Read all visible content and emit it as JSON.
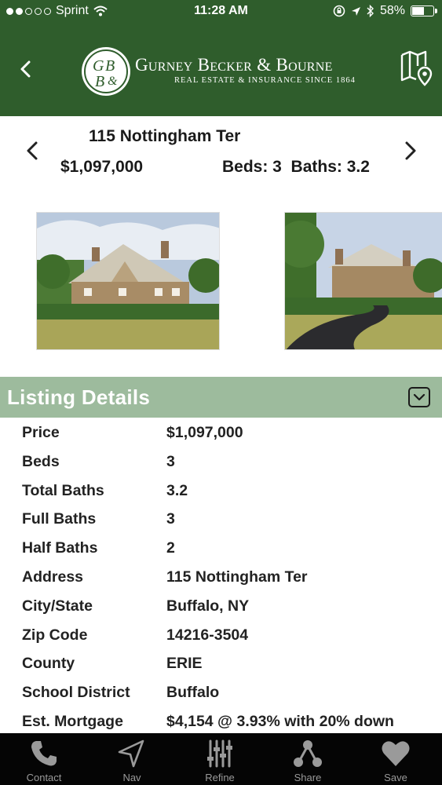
{
  "status_bar": {
    "carrier": "Sprint",
    "time": "11:28 AM",
    "battery": "58%",
    "battery_level": 0.58,
    "signal_bars_filled": 2,
    "signal_bars_total": 5
  },
  "header": {
    "brand_name": "Gurney Becker & Bourne",
    "brand_tagline": "Real Estate & Insurance Since 1864",
    "logo_monogram": "GB&B",
    "back_icon": "chevron-left-icon",
    "map_icon": "map-pin-icon",
    "color": "#2f5d2c"
  },
  "summary": {
    "address": "115 Nottingham Ter",
    "price": "$1,097,000",
    "beds_baths": "Beds: 3  Baths: 3.2"
  },
  "photos": [
    {
      "icon": "house-photo"
    },
    {
      "icon": "house-driveway-photo"
    }
  ],
  "listing_details": {
    "title": "Listing Details",
    "header_color": "#9dbb9d",
    "rows": [
      {
        "label": "Price",
        "value": "$1,097,000"
      },
      {
        "label": "Beds",
        "value": "3"
      },
      {
        "label": "Total Baths",
        "value": "3.2"
      },
      {
        "label": "Full Baths",
        "value": "3"
      },
      {
        "label": "Half Baths",
        "value": "2"
      },
      {
        "label": "Address",
        "value": "115 Nottingham Ter"
      },
      {
        "label": "City/State",
        "value": "Buffalo, NY"
      },
      {
        "label": "Zip Code",
        "value": "14216-3504"
      },
      {
        "label": "County",
        "value": "ERIE"
      },
      {
        "label": "School District",
        "value": "Buffalo"
      },
      {
        "label": "Est. Mortgage",
        "value": "$4,154 @ 3.93% with 20% down"
      }
    ]
  },
  "tabbar": {
    "tabs": [
      {
        "label": "Contact",
        "icon": "phone-icon"
      },
      {
        "label": "Nav",
        "icon": "navigation-arrow-icon"
      },
      {
        "label": "Refine",
        "icon": "sliders-icon"
      },
      {
        "label": "Share",
        "icon": "share-icon"
      },
      {
        "label": "Save",
        "icon": "heart-icon"
      }
    ]
  }
}
